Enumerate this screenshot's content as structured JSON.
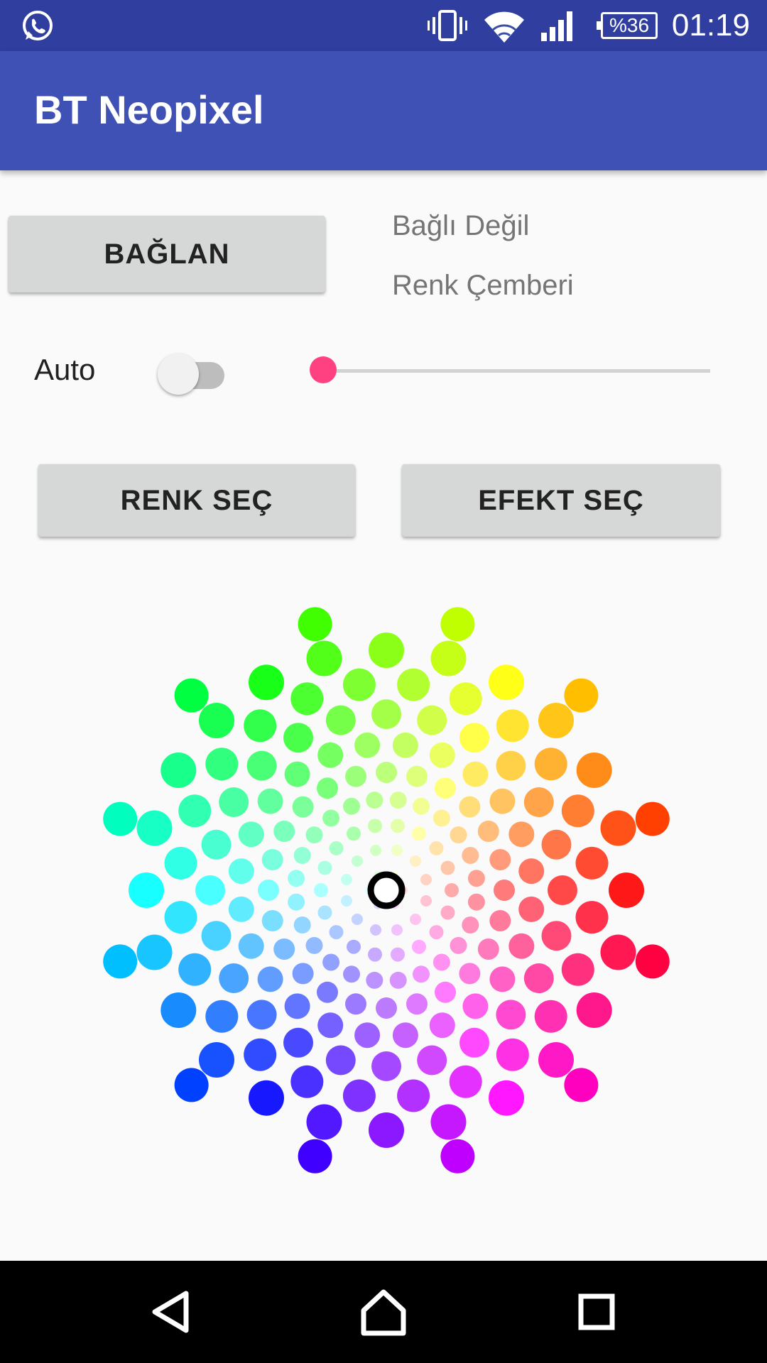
{
  "status_bar": {
    "app_icon": "whatsapp-icon",
    "icons": [
      "vibrate-icon",
      "wifi-icon",
      "cell-signal-icon"
    ],
    "battery_text": "%36",
    "time": "01:19"
  },
  "app_bar": {
    "title": "BT Neopixel"
  },
  "controls": {
    "connect_label": "BAĞLAN",
    "status": "Bağlı Değil",
    "mode": "Renk Çemberi",
    "auto_label": "Auto",
    "auto_enabled": false,
    "slider_value": 0,
    "pick_color_label": "RENK SEÇ",
    "pick_effect_label": "EFEKT SEÇ"
  },
  "color_wheel": {
    "selected_color": "#ffffff",
    "accent": "#ff4081"
  },
  "colors": {
    "status_bar": "#303f9f",
    "app_bar": "#3f51b5",
    "button": "#d6d7d7",
    "accent": "#ff4081"
  },
  "nav_bar": {
    "buttons": [
      "back-icon",
      "home-icon",
      "recents-icon"
    ]
  }
}
